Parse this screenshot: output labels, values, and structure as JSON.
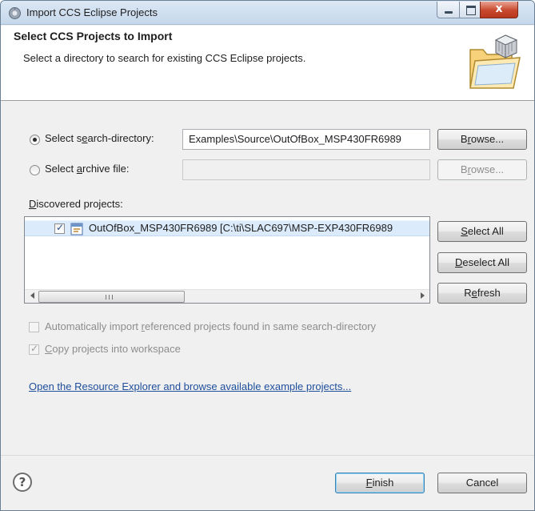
{
  "window": {
    "title": "Import CCS Eclipse Projects",
    "controls": {
      "close_label": "x"
    }
  },
  "banner": {
    "title": "Select CCS Projects to Import",
    "description": "Select a directory to search for existing CCS Eclipse projects."
  },
  "search_directory": {
    "label_pre": "Select s",
    "label_mnemonic": "e",
    "label_post": "arch-directory:",
    "selected": true,
    "value": "Examples\\Source\\OutOfBox_MSP430FR6989",
    "browse_pre": "B",
    "browse_mnemonic": "r",
    "browse_post": "owse..."
  },
  "archive_file": {
    "label_pre": "Select ",
    "label_mnemonic": "a",
    "label_post": "rchive file:",
    "selected": false,
    "value": "",
    "browse_pre": "B",
    "browse_mnemonic": "r",
    "browse_post": "owse..."
  },
  "discovered": {
    "label_mnemonic": "D",
    "label_post": "iscovered projects:",
    "projects": [
      {
        "name": "OutOfBox_MSP430FR6989  [C:\\ti\\SLAC697\\MSP-EXP430FR6989",
        "checked": true
      }
    ],
    "scroll_grip": "III"
  },
  "list_buttons": {
    "select_all_pre": "",
    "select_all_mnemonic": "S",
    "select_all_post": "elect All",
    "deselect_all_mnemonic": "D",
    "deselect_all_post": "eselect All",
    "refresh_pre": "R",
    "refresh_mnemonic": "e",
    "refresh_post": "fresh"
  },
  "options": {
    "auto_import_pre": "Automatically import ",
    "auto_import_mnemonic": "r",
    "auto_import_post": "eferenced projects found in same search-directory",
    "auto_import_checked": false,
    "copy_mnemonic": "C",
    "copy_post": "opy projects into workspace",
    "copy_checked": true
  },
  "resource_link": "Open the Resource Explorer and browse available example projects...",
  "footer": {
    "help_glyph": "?",
    "finish_mnemonic": "F",
    "finish_post": "inish",
    "cancel_label": "Cancel"
  },
  "colors": {
    "accent": "#1e4e9c",
    "selection": "#dcebfc",
    "close_button": "#c7482d"
  }
}
